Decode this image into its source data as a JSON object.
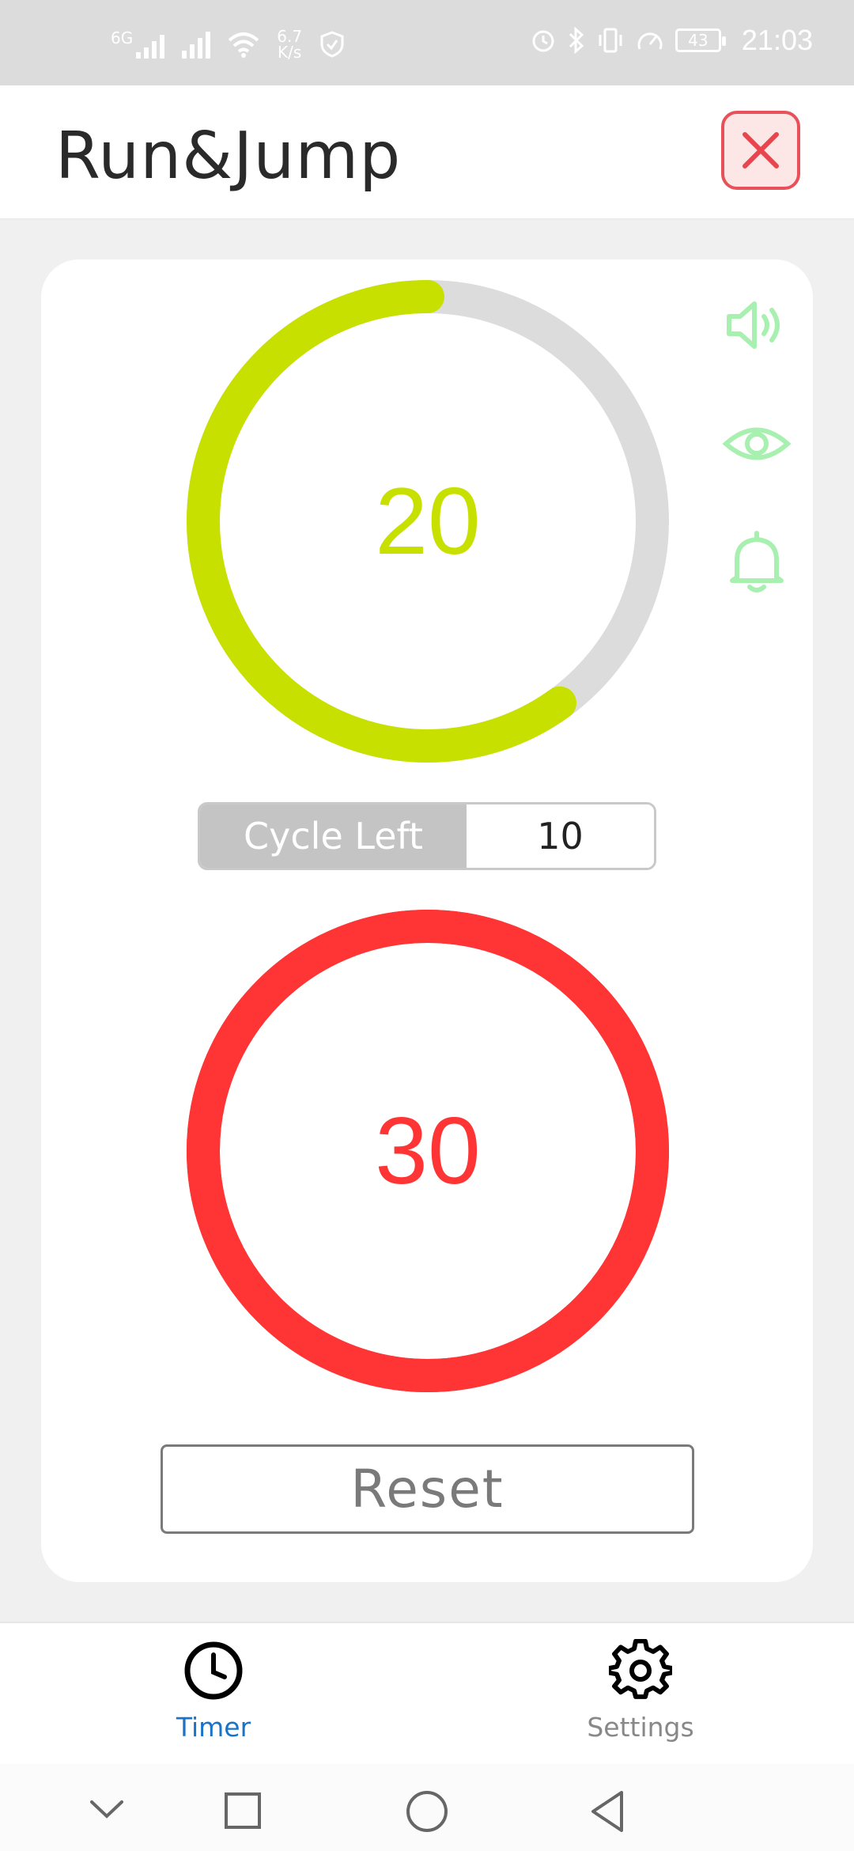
{
  "status_bar": {
    "network_type": "6G",
    "net_speed_value": "6.7",
    "net_speed_unit": "K/s",
    "battery": "43",
    "time": "21:03",
    "icons": [
      "signal-icon",
      "signal-icon",
      "wifi-icon",
      "shield-icon",
      "alarm-icon",
      "bluetooth-icon",
      "vibrate-icon",
      "speedometer-icon",
      "battery-icon"
    ]
  },
  "header": {
    "title": "Run&Jump",
    "close_icon": "close-icon"
  },
  "timer": {
    "run_value": "20",
    "run_color": "#c8e000",
    "run_progress": 0.6,
    "jump_value": "30",
    "jump_color": "#ff3535",
    "jump_progress": 1.0,
    "track_color": "#dcdcdc",
    "cycle_label": "Cycle Left",
    "cycle_value": "10",
    "reset_label": "Reset",
    "side_icons": [
      "sound-icon",
      "eye-icon",
      "bell-icon"
    ],
    "side_icon_color": "#a8f0b0"
  },
  "bottom_nav": {
    "items": [
      {
        "label": "Timer",
        "icon": "clock-icon",
        "active": true,
        "color": "#1a73c8"
      },
      {
        "label": "Settings",
        "icon": "gear-icon",
        "active": false,
        "color": "#888888"
      }
    ]
  },
  "system_nav": [
    "chevron-down-icon",
    "square-icon",
    "circle-icon",
    "back-triangle-icon"
  ]
}
